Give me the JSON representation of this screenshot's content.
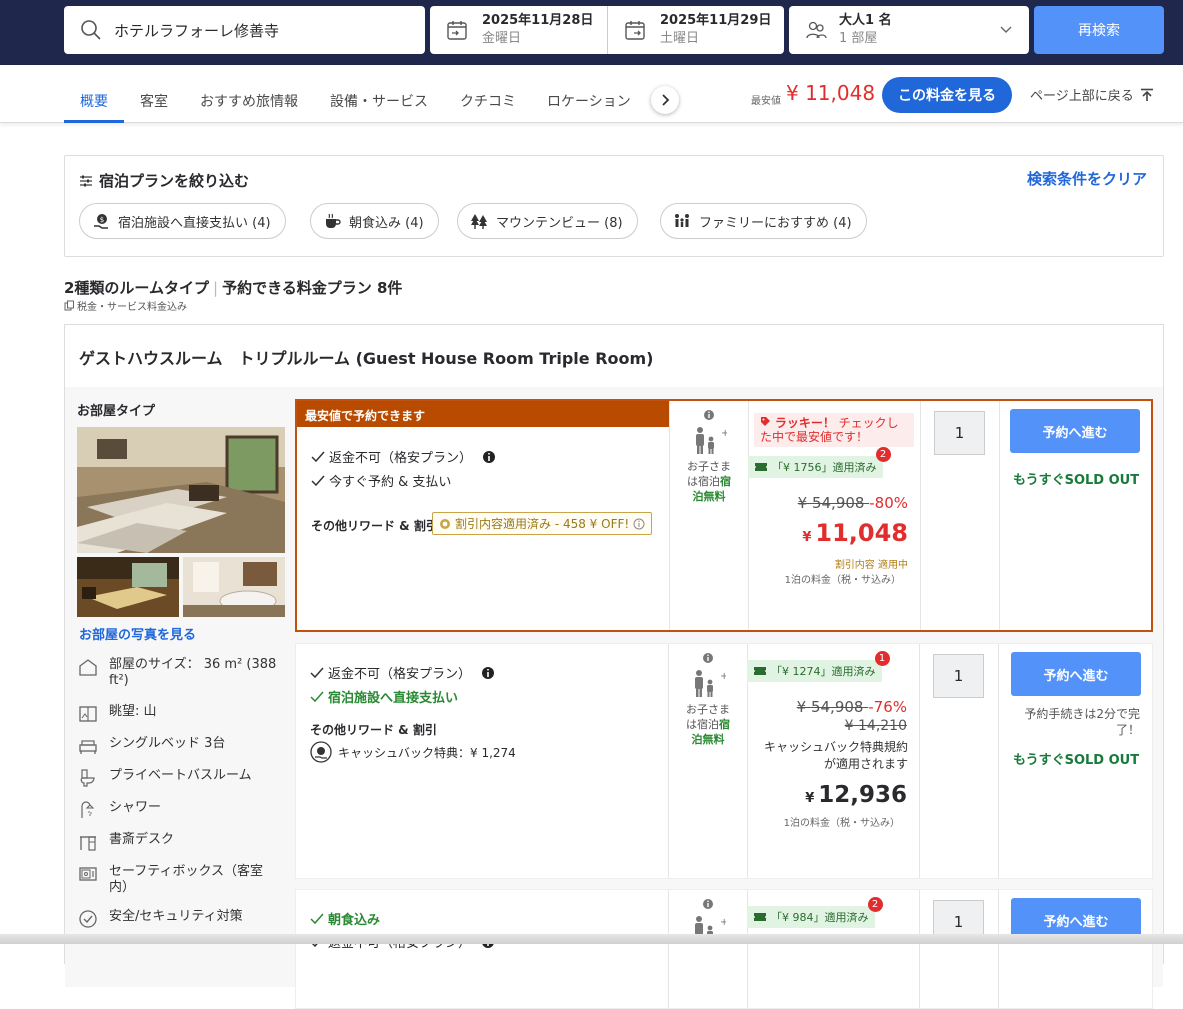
{
  "search": {
    "query": "ホテルラフォーレ修善寺"
  },
  "dates": {
    "checkin": {
      "date": "2025年11月28日",
      "weekday": "金曜日"
    },
    "checkout": {
      "date": "2025年11月29日",
      "weekday": "土曜日"
    }
  },
  "guests": {
    "people": "大人1 名",
    "rooms": "1 部屋"
  },
  "research_label": "再検索",
  "nav": {
    "tabs": [
      "概要",
      "客室",
      "おすすめ旅情報",
      "設備・サービス",
      "クチコミ",
      "ロケーション"
    ],
    "min_price_label": "最安値",
    "min_price": "¥ 11,048",
    "see_price_label": "この料金を見る",
    "back_to_top": "ページ上部に戻る"
  },
  "filter": {
    "title": "宿泊プランを絞り込む",
    "clear": "検索条件をクリア",
    "chips": [
      "宿泊施設へ直接支払い (4)",
      "朝食込み (4)",
      "マウンテンビュー (8)",
      "ファミリーにおすすめ (4)"
    ]
  },
  "summary": {
    "types": "2種類のルームタイプ",
    "plans": "予約できる料金プラン 8件",
    "tax": "税金・サービス料金込み"
  },
  "room": {
    "title": "ゲストハウスルーム　トリプルルーム (Guest House Room Triple Room)",
    "type_label": "お部屋タイプ",
    "photos_link": "お部屋の写真を見る",
    "features": [
      "部屋のサイズ： 36 m² (388 ft²)",
      "眺望: 山",
      "シングルベッド 3台",
      "プライベートバスルーム",
      "シャワー",
      "書斎デスク",
      "セーフティボックス（客室内）",
      "安全/セキュリティ対策"
    ]
  },
  "plans": [
    {
      "banner": "最安値で予約できます",
      "conditions": [
        "返金不可（格安プラン）",
        "今すぐ予約 & 支払い"
      ],
      "reward_label": "その他リワード & 割引",
      "reward_tag": "割引内容適用済み - 458 ¥ OFF!",
      "kids": [
        "お子さま",
        "は宿泊",
        "宿",
        "泊無料"
      ],
      "lucky": "ラッキー！ チェックした中で最安値です！",
      "lucky_strong": "ラッキー！",
      "lucky_rest": "チェックした中で最安値です！",
      "coupon": "「¥ 1756」適用済み",
      "coupon_count": "2",
      "original": "¥ 54,908",
      "discount": "-80%",
      "price_yen": "¥",
      "price": "11,048",
      "price_note": "割引内容 適用中",
      "per_night": "1泊の料金（税・サ込み）",
      "qty": "1",
      "book": "予約へ進む",
      "soldout": "もうすぐSOLD OUT"
    },
    {
      "conditions": [
        "返金不可（格安プラン）",
        "宿泊施設へ直接支払い"
      ],
      "reward_label": "その他リワード & 割引",
      "cashback": "キャッシュバック特典：¥ 1,274",
      "kids": [
        "お子さま",
        "は宿泊",
        "宿",
        "泊無料"
      ],
      "coupon": "「¥ 1274」適用済み",
      "coupon_count": "1",
      "original": "¥ 54,908",
      "discount": "-76%",
      "original2": "¥ 14,210",
      "cashback_note": "キャッシュバック特典規約が適用されます",
      "price_yen": "¥",
      "price": "12,936",
      "per_night": "1泊の料金（税・サ込み）",
      "qty": "1",
      "book": "予約へ進む",
      "quick": "予約手続きは2分で完了！",
      "soldout": "もうすぐSOLD OUT"
    },
    {
      "conditions": [
        "朝食込み",
        "返金不可（格安プラン）"
      ],
      "coupon": "「¥ 984」適用済み",
      "coupon_count": "2",
      "qty": "1",
      "book": "予約へ進む"
    }
  ]
}
